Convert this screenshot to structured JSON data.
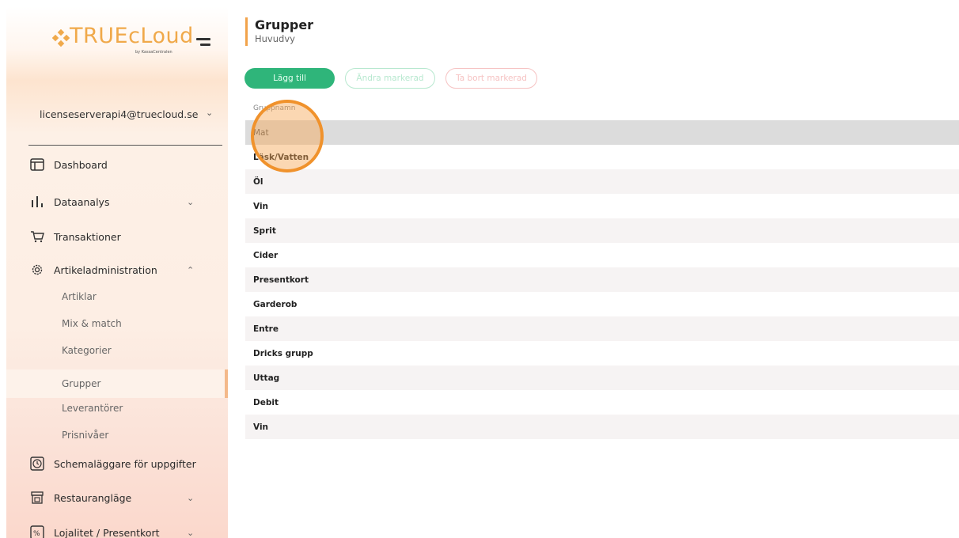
{
  "brand": {
    "logo_text": "TRUEcLoud",
    "logo_subtext": "by KassaCentralen",
    "accent": "#f0a94a"
  },
  "account": {
    "email": "licenseserverapi4@truecloud.se",
    "icon": "chevron-down-icon"
  },
  "nav": {
    "dashboard": "Dashboard",
    "dataanalys": "Dataanalys",
    "transaktioner": "Transaktioner",
    "artikeladministration": "Artikeladministration",
    "sub": {
      "artiklar": "Artiklar",
      "mix_match": "Mix & match",
      "kategorier": "Kategorier",
      "grupper": "Grupper",
      "leverantorer": "Leverantörer",
      "prisnivaer": "Prisnivåer"
    },
    "schemalaggare": "Schemaläggare för uppgifter",
    "restauranglage": "Restaurangläge",
    "lojalitet": "Lojalitet / Presentkort"
  },
  "page": {
    "title": "Grupper",
    "subtitle": "Huvudvy"
  },
  "toolbar": {
    "add_label": "Lägg till",
    "edit_label": "Ändra markerad",
    "delete_label": "Ta bort markerad",
    "colors": {
      "add": "#2fb57a",
      "edit": "#b7e8cf",
      "delete": "#f6c3c3"
    }
  },
  "table": {
    "header": "Gruppnamn",
    "rows": [
      "Mat",
      "Läsk/Vatten",
      "Öl",
      "Vin",
      "Sprit",
      "Cider",
      "Presentkort",
      "Garderob",
      "Entre",
      "Dricks grupp",
      "Uttag",
      "Debit",
      "Vin"
    ],
    "selected_index": 0
  }
}
